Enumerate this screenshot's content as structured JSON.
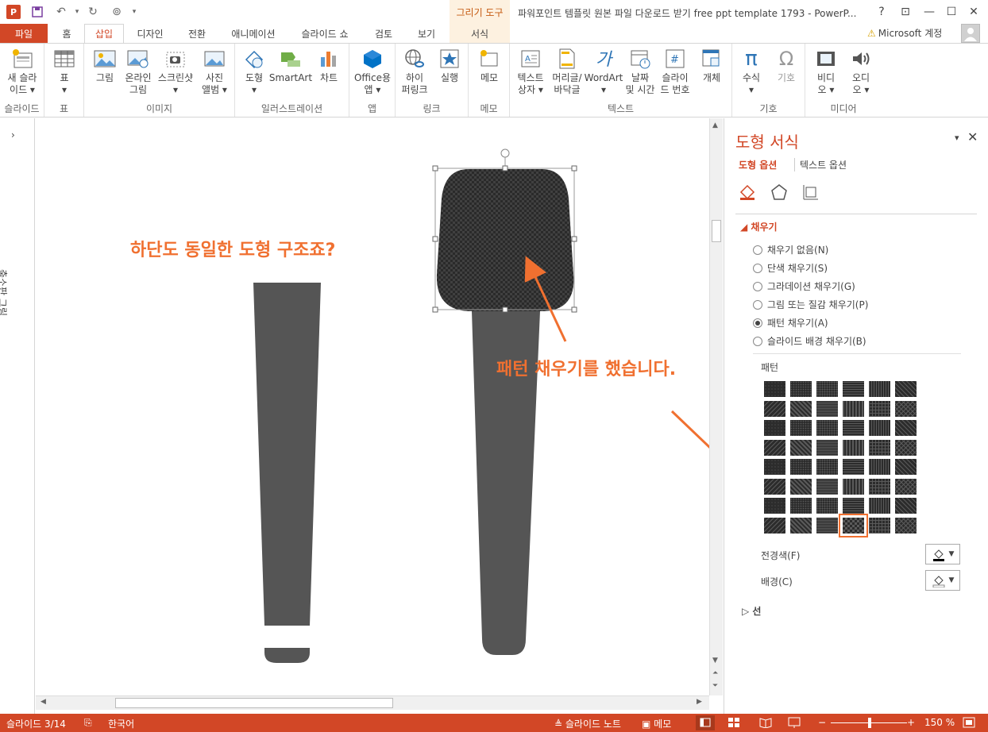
{
  "titlebar": {
    "app_badge": "P",
    "drawing_tools": "그리기 도구",
    "window_title": "파워포인트 템플릿 원본 파일 다운로드 받기 free ppt template 1793 - PowerP...",
    "help": "?",
    "restore_ribbon": "⊡",
    "minimize": "—",
    "maximize": "☐",
    "close": "✕"
  },
  "tabs": {
    "file": "파일",
    "home": "홈",
    "insert": "삽입",
    "design": "디자인",
    "transitions": "전환",
    "animations": "애니메이션",
    "slideshow": "슬라이드 쇼",
    "review": "검토",
    "view": "보기",
    "format": "서식"
  },
  "account": {
    "label": "Microsoft 계정",
    "warn": "⚠"
  },
  "ribbon": {
    "new_slide": "새 슬라\n이드 ▾",
    "table": "표\n▾",
    "picture": "그림",
    "online_picture": "온라인\n그림",
    "screenshot": "스크린샷\n▾",
    "photo_album": "사진\n앨범 ▾",
    "shapes": "도형\n▾",
    "smartart": "SmartArt",
    "chart": "차트",
    "office_apps": "Office용\n앱 ▾",
    "hyperlink": "하이\n퍼링크",
    "action": "실행",
    "comment": "메모",
    "textbox": "텍스트\n상자 ▾",
    "header_footer": "머리글/\n바닥글",
    "wordart": "WordArt\n▾",
    "datetime": "날짜\n및 시간",
    "slide_number": "슬라이\n드 번호",
    "object": "개체",
    "equation": "수식\n▾",
    "symbol": "기호",
    "video": "비디\n오 ▾",
    "audio": "오디\n오 ▾",
    "groups": {
      "slides": "슬라이드",
      "tables": "표",
      "images": "이미지",
      "illustrations": "일러스트레이션",
      "apps": "앱",
      "links": "링크",
      "comments": "메모",
      "text": "텍스트",
      "symbols": "기호",
      "media": "미디어"
    }
  },
  "thumbnail_pane": {
    "label": "축소판 그림",
    "chevron": "›"
  },
  "slide": {
    "callout_top": "하단도 동일한 도형 구조죠?",
    "callout_pattern": "패턴 채우기를 했습니다."
  },
  "format_pane": {
    "title": "도형 서식",
    "tab_shape": "도형 옵션",
    "tab_text": "텍스트 옵션",
    "fill_header": "◢ 채우기",
    "fill_options": [
      {
        "label": "채우기 없음(N)",
        "checked": false
      },
      {
        "label": "단색 채우기(S)",
        "checked": false
      },
      {
        "label": "그라데이션 채우기(G)",
        "checked": false
      },
      {
        "label": "그림 또는 질감 채우기(P)",
        "checked": false
      },
      {
        "label": "패턴 채우기(A)",
        "checked": true
      },
      {
        "label": "슬라이드 배경 채우기(B)",
        "checked": false
      }
    ],
    "pattern_label": "패턴",
    "foreground_label": "전경색(F)",
    "background_label": "배경(C)",
    "line_header": "▷ 선",
    "selected_pattern": {
      "row": 8,
      "col": 4
    }
  },
  "statusbar": {
    "slide_info": "슬라이드 3/14",
    "language": "한국어",
    "notes": "≜ 슬라이드 노트",
    "comments": "▣ 메모",
    "zoom": "150 %"
  },
  "colors": {
    "accent": "#d24726",
    "shape_fill": "#555555",
    "callout": "#f07030"
  }
}
